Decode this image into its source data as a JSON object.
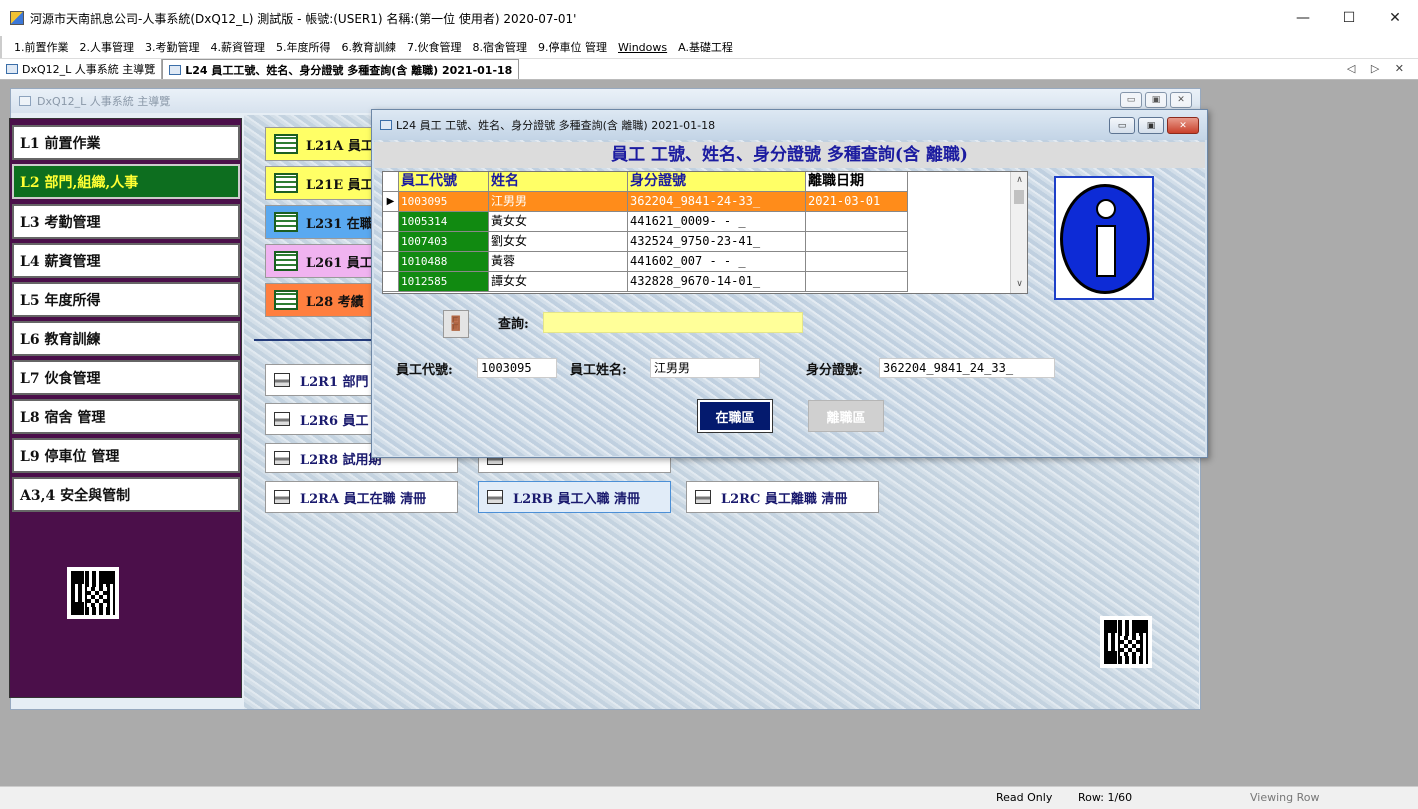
{
  "window": {
    "title": "河源市天南訊息公司-人事系統(DxQ12_L) 測試版 - 帳號:(USER1) 名稱:(第一位 使用者) 2020-07-01'",
    "minimize": "—",
    "maximize": "☐",
    "close": "✕"
  },
  "menu": [
    "1.前置作業",
    "2.人事管理",
    "3.考勤管理",
    "4.薪資管理",
    "5.年度所得",
    "6.教育訓練",
    "7.伙食管理",
    "8.宿舍管理",
    "9.停車位 管理",
    "Windows",
    "A.基礎工程"
  ],
  "tabs": {
    "tab1": "DxQ12_L 人事系統 主導覽",
    "tab2": "L24 員工工號、姓名、身分證號 多種查詢(含 離職) 2021-01-18",
    "nav": "◁ ▷ ✕"
  },
  "main_window": {
    "title": "DxQ12_L 人事系統 主導覽"
  },
  "sidebar": {
    "items": [
      "L1 前置作業",
      "L2 部門,組織,人事",
      "L3 考勤管理",
      "L4 薪資管理",
      "L5 年度所得",
      "L6 教育訓練",
      "L7 伙食管理",
      "L8 宿舍 管理",
      "L9 停車位 管理",
      "A3,4 安全與管制"
    ],
    "active_index": 1
  },
  "modules": [
    {
      "label": "L21A 員工",
      "color": "#ffff66"
    },
    {
      "label": "L21E 員工",
      "color": "#ffff66"
    },
    {
      "label": "L231 在職",
      "color": "#5aa9f0"
    },
    {
      "label": "L261 員工",
      "color": "#f0b3f0"
    },
    {
      "label": "L28 考績",
      "color": "#ff7f3f"
    }
  ],
  "reports": {
    "r1": "L2R1 部門",
    "r2": "L2R6 員工",
    "r3": "L2R8 試用期",
    "r4": "L2RA 員工在職 清冊",
    "r5": "L2RB 員工入職 清冊",
    "r6": "L2RC 員工離職 清冊"
  },
  "dialog": {
    "title": "L24 員工 工號、姓名、身分證號 多種查詢(含 離職) 2021-01-18",
    "heading": "員工 工號、姓名、身分證號 多種查詢(含 離職)",
    "columns": [
      "員工代號",
      "姓名",
      "身分證號",
      "離職日期"
    ],
    "rows": [
      [
        "1003095",
        "江男男",
        "362204_9841-24-33_",
        "2021-03-01"
      ],
      [
        "1005314",
        "黃女女",
        "441621_0009-  -  _",
        ""
      ],
      [
        "1007403",
        "劉女女",
        "432524_9750-23-41_",
        ""
      ],
      [
        "1010488",
        "黃蓉",
        "441602_007 -  -  _",
        ""
      ],
      [
        "1012585",
        "譚女女",
        "432828_9670-14-01_",
        ""
      ]
    ],
    "selected_row": 0,
    "search_label": "查詢:",
    "search_value": "",
    "emp_code_label": "員工代號:",
    "emp_code_value": "1003095",
    "emp_name_label": "員工姓名:",
    "emp_name_value": "江男男",
    "id_label": "身分證號:",
    "id_value": "362204_9841_24_33_",
    "btn_active": "在職區",
    "btn_inactive": "離職區"
  },
  "status": {
    "mode": "Read Only",
    "row": "Row: 1/60",
    "state": "Viewing Row"
  }
}
